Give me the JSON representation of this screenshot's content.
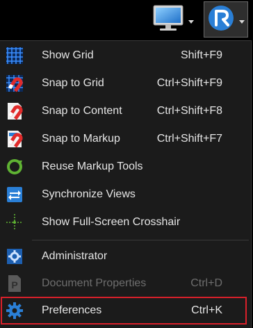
{
  "toolbar": {
    "monitor_icon": "monitor-icon",
    "logo_icon": "bluebeam-logo-icon"
  },
  "menu": {
    "items": [
      {
        "label": "Show Grid",
        "shortcut": "Shift+F9",
        "icon": "grid-icon"
      },
      {
        "label": "Snap to Grid",
        "shortcut": "Ctrl+Shift+F9",
        "icon": "snap-grid-icon"
      },
      {
        "label": "Snap to Content",
        "shortcut": "Ctrl+Shift+F8",
        "icon": "snap-content-icon"
      },
      {
        "label": "Snap to Markup",
        "shortcut": "Ctrl+Shift+F7",
        "icon": "snap-markup-icon"
      },
      {
        "label": "Reuse Markup Tools",
        "shortcut": "",
        "icon": "reuse-tools-icon"
      },
      {
        "label": "Synchronize Views",
        "shortcut": "",
        "icon": "sync-icon"
      },
      {
        "label": "Show Full-Screen Crosshair",
        "shortcut": "",
        "icon": "crosshair-icon"
      },
      {
        "label": "Administrator",
        "shortcut": "",
        "icon": "administrator-icon"
      },
      {
        "label": "Document Properties",
        "shortcut": "Ctrl+D",
        "icon": "document-properties-icon",
        "disabled": true
      },
      {
        "label": "Preferences",
        "shortcut": "Ctrl+K",
        "icon": "gear-icon"
      }
    ]
  },
  "colors": {
    "background": "#1b1b1b",
    "text": "#e6e6e6",
    "disabled_text": "#6e6e6e",
    "highlight_border": "#d9202a",
    "accent_blue": "#2a7fd6"
  }
}
